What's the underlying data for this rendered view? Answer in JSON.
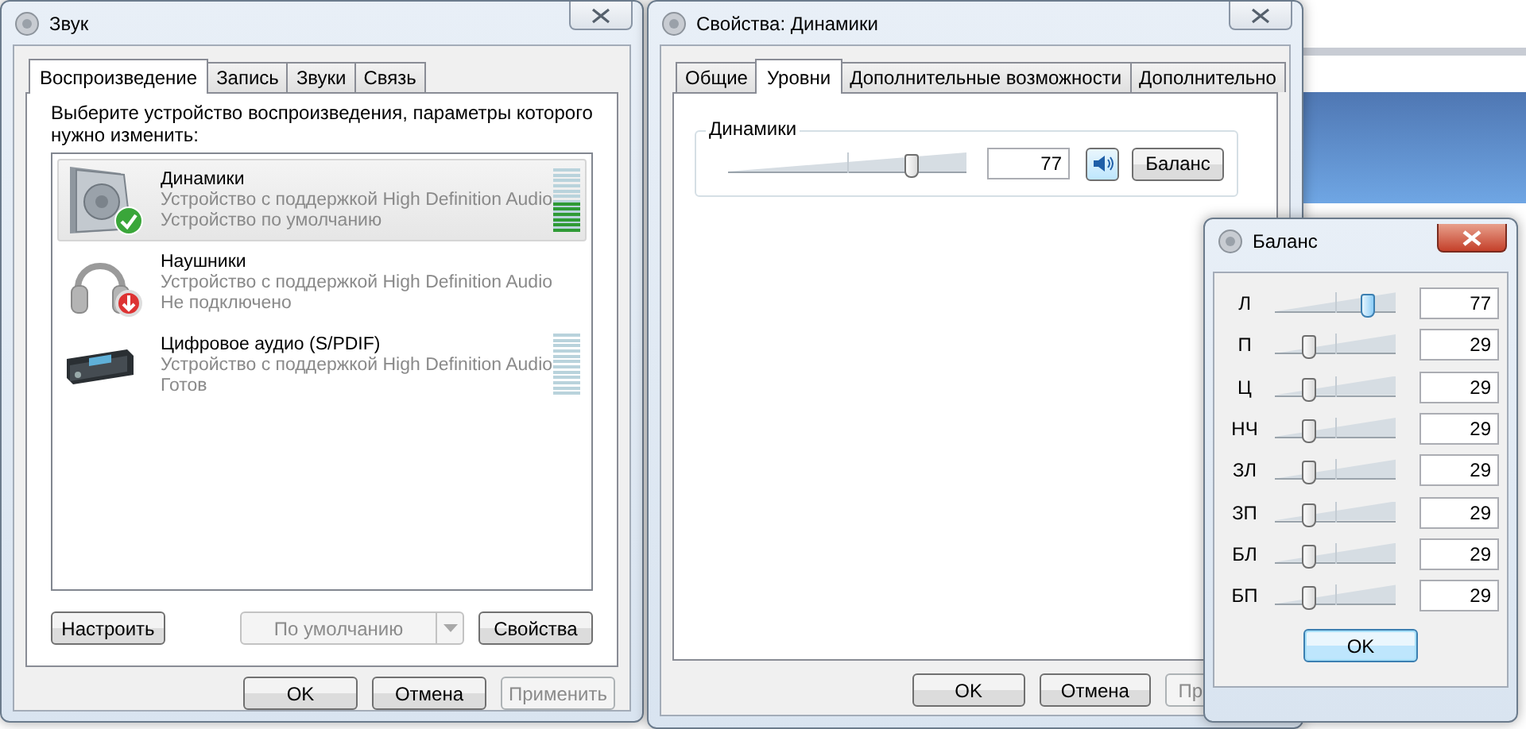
{
  "sound_window": {
    "title": "Звук",
    "tabs": [
      {
        "label": "Воспроизведение",
        "selected": true
      },
      {
        "label": "Запись",
        "selected": false
      },
      {
        "label": "Звуки",
        "selected": false
      },
      {
        "label": "Связь",
        "selected": false
      }
    ],
    "instruction": "Выберите устройство воспроизведения, параметры которого нужно изменить:",
    "devices": [
      {
        "kind": "speakers",
        "name": "Динамики",
        "description": "Устройство с поддержкой High Definition Audio",
        "status": "Устройство по умолчанию",
        "is_default": true,
        "connected": true,
        "selected": true,
        "level": 0.5
      },
      {
        "kind": "headphones",
        "name": "Наушники",
        "description": "Устройство с поддержкой High Definition Audio",
        "status": "Не подключено",
        "is_default": false,
        "connected": false,
        "selected": false
      },
      {
        "kind": "digital",
        "name": "Цифровое аудио (S/PDIF)",
        "description": "Устройство с поддержкой High Definition Audio",
        "status": "Готов",
        "is_default": false,
        "connected": true,
        "selected": false,
        "level": 0
      }
    ],
    "configure_button": "Настроить",
    "default_dropdown": {
      "label": "По умолчанию",
      "disabled": true
    },
    "properties_button": "Свойства",
    "buttons": [
      {
        "label": "OK",
        "disabled": false
      },
      {
        "label": "Отмена",
        "disabled": false
      },
      {
        "label": "Применить",
        "disabled": true
      }
    ]
  },
  "properties_window": {
    "title": "Свойства: Динамики",
    "tabs": [
      {
        "label": "Общие",
        "selected": false
      },
      {
        "label": "Уровни",
        "selected": true
      },
      {
        "label": "Дополнительные возможности",
        "selected": false
      },
      {
        "label": "Дополнительно",
        "selected": false
      }
    ],
    "group_label": "Динамики",
    "volume": {
      "level": 0.77,
      "value": "77",
      "muted": false
    },
    "balance_button": "Баланс",
    "buttons": [
      {
        "label": "OK",
        "disabled": false
      },
      {
        "label": "Отмена",
        "disabled": false
      },
      {
        "label": "Пр",
        "disabled": true
      }
    ]
  },
  "balance_window": {
    "title": "Баланс",
    "channels": [
      {
        "label": "Л",
        "level": 0.77,
        "value": "77",
        "focused": true
      },
      {
        "label": "П",
        "level": 0.29,
        "value": "29",
        "focused": false
      },
      {
        "label": "Ц",
        "level": 0.29,
        "value": "29",
        "focused": false
      },
      {
        "label": "НЧ",
        "level": 0.29,
        "value": "29",
        "focused": false
      },
      {
        "label": "ЗЛ",
        "level": 0.29,
        "value": "29",
        "focused": false
      },
      {
        "label": "ЗП",
        "level": 0.29,
        "value": "29",
        "focused": false
      },
      {
        "label": "БЛ",
        "level": 0.29,
        "value": "29",
        "focused": false
      },
      {
        "label": "БП",
        "level": 0.29,
        "value": "29",
        "focused": false
      }
    ],
    "ok_button": "OK"
  }
}
